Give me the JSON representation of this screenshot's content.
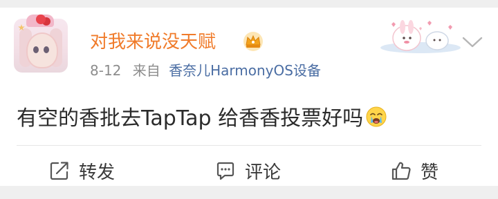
{
  "post": {
    "username": "对我来说没天赋",
    "date": "8-12",
    "from_label": "来自",
    "source": "香奈儿HarmonyOS设备",
    "content": "有空的香批去TapTap 给香香投票好吗"
  },
  "actions": {
    "repost_label": "转发",
    "comment_label": "评论",
    "like_label": "赞"
  },
  "colors": {
    "username": "#f07b2a",
    "source_link": "#4a6da3",
    "meta": "#8c8c8c",
    "text": "#2b2b2b",
    "background": "#efefef",
    "card": "#ffffff"
  },
  "icons": {
    "vip_badge": "crown-badge-icon",
    "chevron": "chevron-down-icon",
    "repost": "repost-icon",
    "comment": "comment-icon",
    "like": "thumbs-up-icon",
    "emoji": "crying-face-emoji-icon"
  }
}
